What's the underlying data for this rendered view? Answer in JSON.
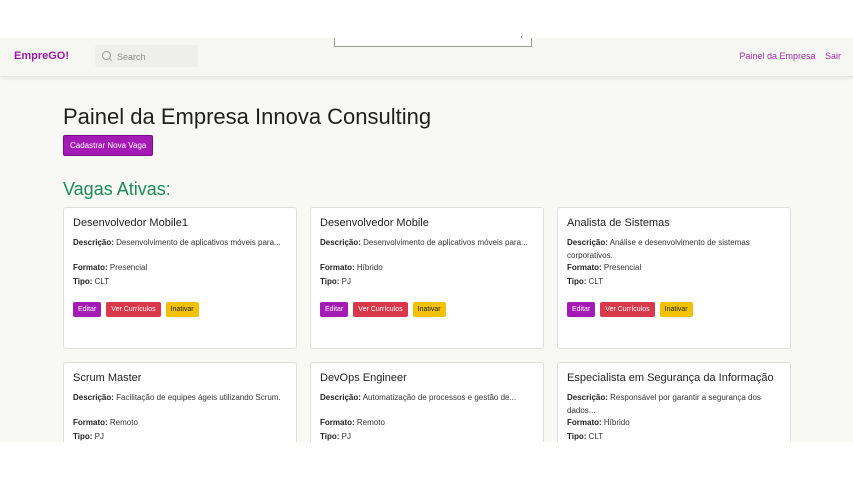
{
  "navbar": {
    "brand": "EmpreGO!",
    "search_placeholder": "Search",
    "links": [
      "Painel da Empresa",
      "Sair"
    ]
  },
  "page": {
    "title": "Painel da Empresa Innova Consulting",
    "new_job_button": "Cadastrar Nova Vaga",
    "section_title": "Vagas Ativas:"
  },
  "labels": {
    "description": "Descrição:",
    "format": "Formato:",
    "type": "Tipo:",
    "edit": "Editar",
    "view_resumes": "Ver Currículos",
    "deactivate": "Inativar"
  },
  "jobs": [
    {
      "title": "Desenvolvedor Mobile1",
      "description": "Desenvolvimento de aplicativos móveis para...",
      "format": "Presencial",
      "type": "CLT"
    },
    {
      "title": "Desenvolvedor Mobile",
      "description": "Desenvolvimento de aplicativos móveis para...",
      "format": "Híbrido",
      "type": "PJ"
    },
    {
      "title": "Analista de Sistemas",
      "description": "Análise e desenvolvimento de sistemas corporativos.",
      "format": "Presencial",
      "type": "CLT"
    },
    {
      "title": "Scrum Master",
      "description": "Facilitação de equipes ágeis utilizando Scrum.",
      "format": "Remoto",
      "type": "PJ"
    },
    {
      "title": "DevOps Engineer",
      "description": "Automatização de processos e gestão de...",
      "format": "Remoto",
      "type": "PJ"
    },
    {
      "title": "Especialista em Segurança da Informação",
      "description": "Responsável por garantir a segurança dos dados...",
      "format": "Híbrido",
      "type": "CLT"
    }
  ]
}
